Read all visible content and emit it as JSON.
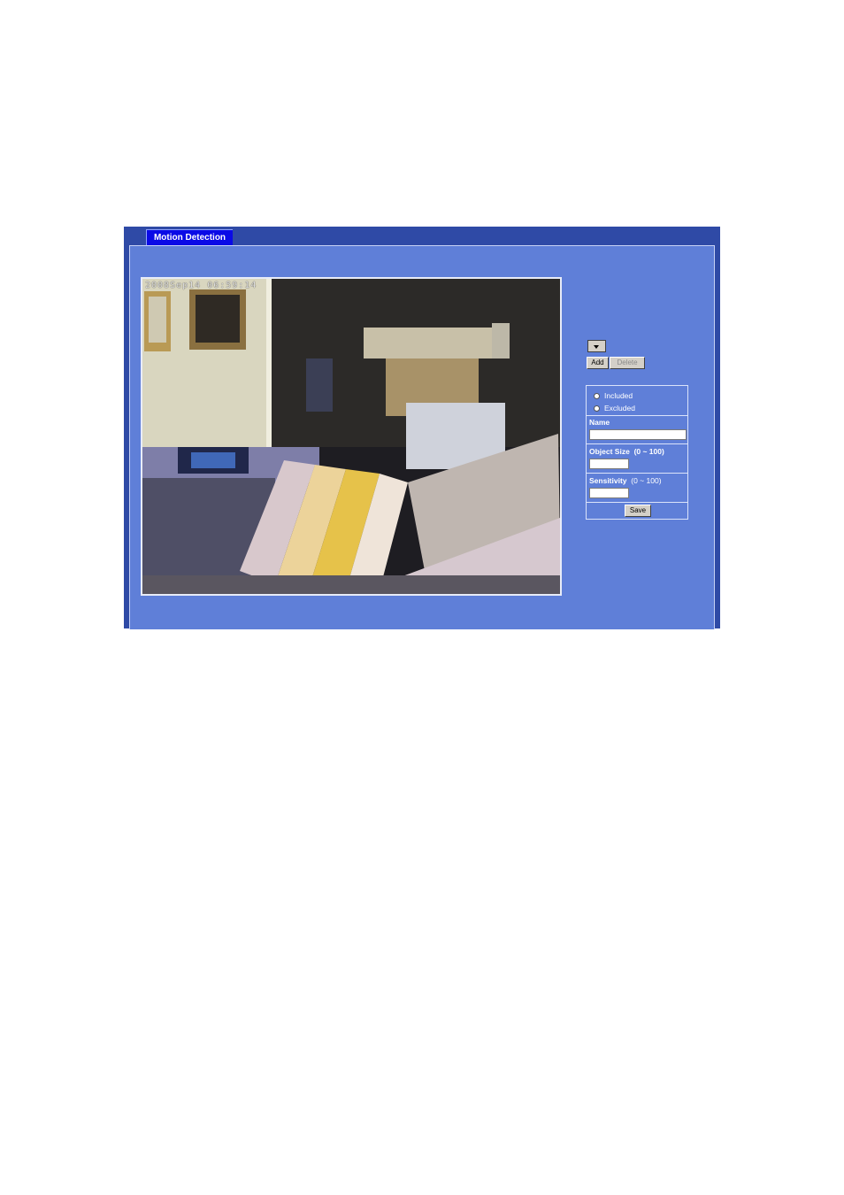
{
  "tab": {
    "label": "Motion Detection"
  },
  "video": {
    "timestamp": "2008Sep14 06:59:14"
  },
  "window_select": {
    "value": ""
  },
  "buttons": {
    "add": "Add",
    "delete": "Delete",
    "save": "Save"
  },
  "mode": {
    "included": "Included",
    "excluded": "Excluded"
  },
  "fields": {
    "name": {
      "label": "Name",
      "value": ""
    },
    "object_size": {
      "label": "Object Size",
      "range": "(0 ~ 100)",
      "value": ""
    },
    "sensitivity": {
      "label": "Sensitivity",
      "range": "(0 ~ 100)",
      "value": ""
    }
  },
  "colors": {
    "frame": "#2f4aa6",
    "panel": "#5f7fd8",
    "tab": "#0a0ae6"
  }
}
